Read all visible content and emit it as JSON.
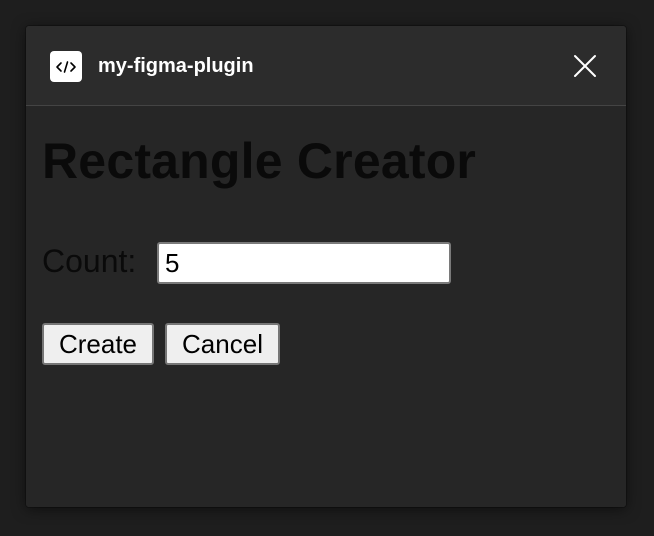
{
  "window": {
    "title": "my-figma-plugin",
    "plugin_icon": "code-brackets-icon",
    "close_icon": "close-icon"
  },
  "main": {
    "heading": "Rectangle Creator",
    "count_label": "Count:",
    "count_value": "5",
    "create_label": "Create",
    "cancel_label": "Cancel"
  },
  "colors": {
    "backdrop": "#1e1e1e",
    "window_bg": "#2c2c2c",
    "content_bg": "#262626",
    "divider": "#444444",
    "title_text": "#ffffff",
    "content_text": "#0a0a0a"
  }
}
